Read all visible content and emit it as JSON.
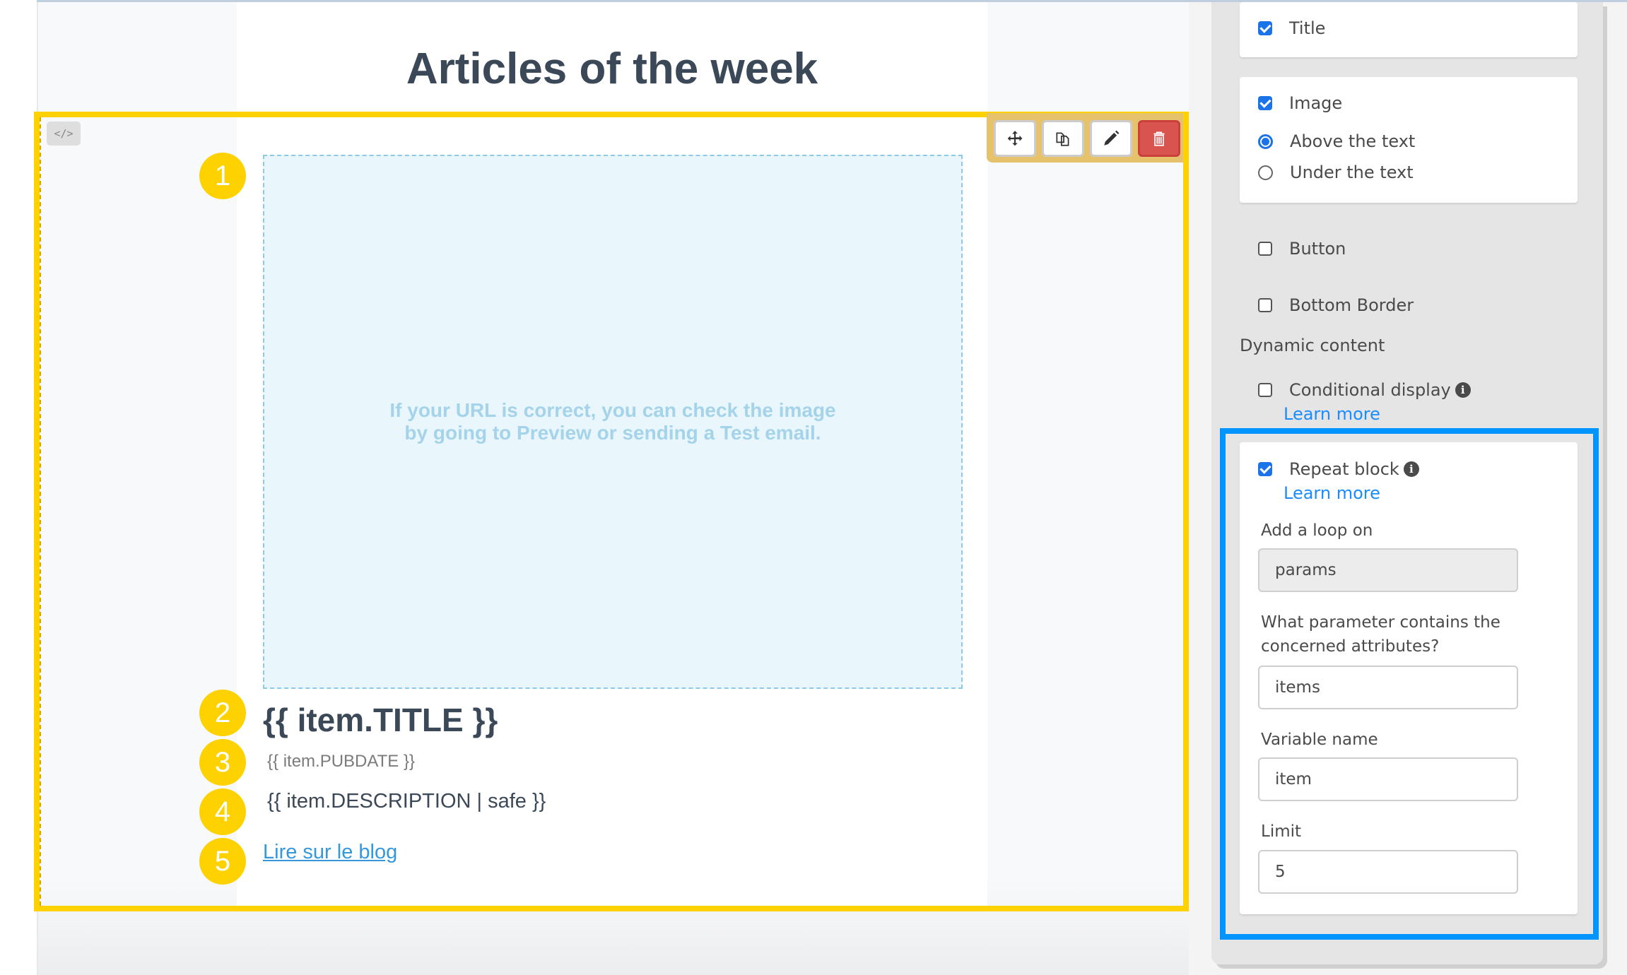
{
  "email": {
    "headline": "Articles of the week",
    "code_button_label": "</>",
    "image_placeholder_text": "If your URL is correct, you can check the image by going to Preview or sending a Test email.",
    "item_title": "{{ item.TITLE }}",
    "item_pubdate": "{{ item.PUBDATE }}",
    "item_description": "{{ item.DESCRIPTION | safe }}",
    "item_link": "Lire sur le blog",
    "badges": [
      "1",
      "2",
      "3",
      "4",
      "5"
    ]
  },
  "toolbar": {
    "move": "move-icon",
    "duplicate": "duplicate-icon",
    "edit": "pencil-icon",
    "delete": "trash-icon"
  },
  "settings": {
    "title": {
      "label": "Title",
      "checked": true
    },
    "image": {
      "label": "Image",
      "checked": true
    },
    "image_position": {
      "options": [
        "Above the text",
        "Under the text"
      ],
      "selected": "Above the text"
    },
    "button": {
      "label": "Button",
      "checked": false
    },
    "bottom_border": {
      "label": "Bottom Border",
      "checked": false
    },
    "dynamic_content_heading": "Dynamic content",
    "conditional_display": {
      "label": "Conditional display",
      "checked": false,
      "learn_more": "Learn more"
    },
    "repeat_block": {
      "label": "Repeat block",
      "checked": true,
      "learn_more": "Learn more",
      "loop_on_label": "Add a loop on",
      "loop_on_value": "params",
      "parameter_label": "What parameter contains the concerned attributes?",
      "parameter_value": "items",
      "variable_label": "Variable name",
      "variable_value": "item",
      "limit_label": "Limit",
      "limit_value": "5"
    }
  },
  "colors": {
    "highlight_yellow": "#fed200",
    "highlight_blue": "#0094ff",
    "accent_blue": "#1a73e8",
    "delete_red": "#d9534f",
    "link_blue": "#3498db"
  }
}
